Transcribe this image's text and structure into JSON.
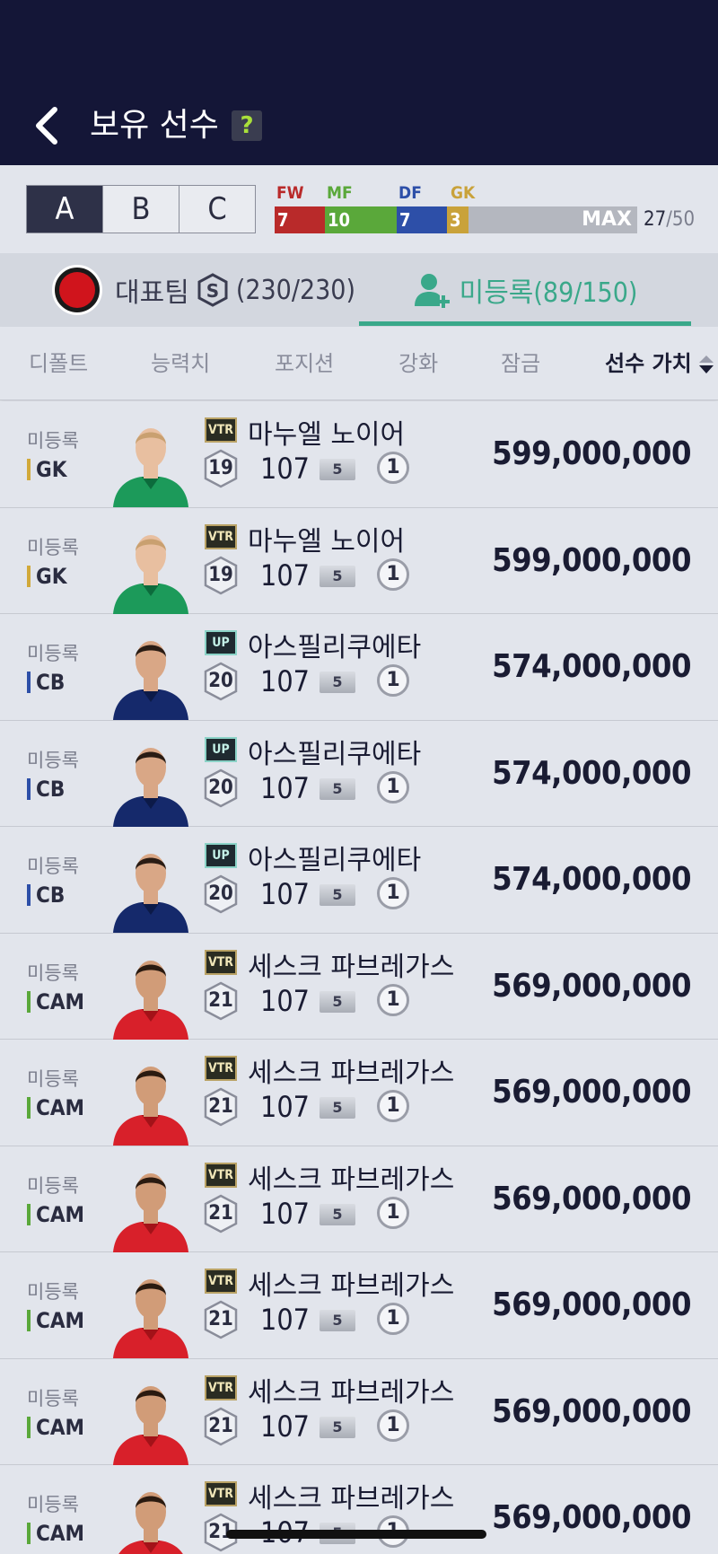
{
  "header": {
    "title": "보유 선수",
    "help": "?"
  },
  "squad": {
    "tabs": [
      "A",
      "B",
      "C"
    ],
    "active": 0,
    "positions": [
      {
        "label": "FW",
        "count": "7",
        "color": "#b92a2a"
      },
      {
        "label": "MF",
        "count": "10",
        "color": "#5aa83a"
      },
      {
        "label": "DF",
        "count": "7",
        "color": "#2d4fa8"
      },
      {
        "label": "GK",
        "count": "3",
        "color": "#c9a23a"
      }
    ],
    "max_label": "MAX",
    "current": "27",
    "max": "/50"
  },
  "team": {
    "main_label": "대표팀",
    "s_badge": "S",
    "main_count": "(230/230)",
    "unregistered_label": "미등록(89/150)"
  },
  "sort": {
    "items": [
      "디폴트",
      "능력치",
      "포지션",
      "강화",
      "잠금",
      "선수 가치"
    ],
    "active": 5
  },
  "players": [
    {
      "status": "미등록",
      "pos": "GK",
      "pos_color": "#d1a93a",
      "season": "VTR",
      "name": "마누엘 노이어",
      "level": "19",
      "ovr": "107",
      "enh": "5",
      "count": "1",
      "value": "599,000,000",
      "kit": "gk"
    },
    {
      "status": "미등록",
      "pos": "GK",
      "pos_color": "#d1a93a",
      "season": "VTR",
      "name": "마누엘 노이어",
      "level": "19",
      "ovr": "107",
      "enh": "5",
      "count": "1",
      "value": "599,000,000",
      "kit": "gk"
    },
    {
      "status": "미등록",
      "pos": "CB",
      "pos_color": "#2d4fa8",
      "season": "UP",
      "name": "아스필리쿠에타",
      "level": "20",
      "ovr": "107",
      "enh": "5",
      "count": "1",
      "value": "574,000,000",
      "kit": "blue"
    },
    {
      "status": "미등록",
      "pos": "CB",
      "pos_color": "#2d4fa8",
      "season": "UP",
      "name": "아스필리쿠에타",
      "level": "20",
      "ovr": "107",
      "enh": "5",
      "count": "1",
      "value": "574,000,000",
      "kit": "blue"
    },
    {
      "status": "미등록",
      "pos": "CB",
      "pos_color": "#2d4fa8",
      "season": "UP",
      "name": "아스필리쿠에타",
      "level": "20",
      "ovr": "107",
      "enh": "5",
      "count": "1",
      "value": "574,000,000",
      "kit": "blue"
    },
    {
      "status": "미등록",
      "pos": "CAM",
      "pos_color": "#5aa83a",
      "season": "VTR",
      "name": "세스크 파브레가스",
      "level": "21",
      "ovr": "107",
      "enh": "5",
      "count": "1",
      "value": "569,000,000",
      "kit": "red"
    },
    {
      "status": "미등록",
      "pos": "CAM",
      "pos_color": "#5aa83a",
      "season": "VTR",
      "name": "세스크 파브레가스",
      "level": "21",
      "ovr": "107",
      "enh": "5",
      "count": "1",
      "value": "569,000,000",
      "kit": "red"
    },
    {
      "status": "미등록",
      "pos": "CAM",
      "pos_color": "#5aa83a",
      "season": "VTR",
      "name": "세스크 파브레가스",
      "level": "21",
      "ovr": "107",
      "enh": "5",
      "count": "1",
      "value": "569,000,000",
      "kit": "red"
    },
    {
      "status": "미등록",
      "pos": "CAM",
      "pos_color": "#5aa83a",
      "season": "VTR",
      "name": "세스크 파브레가스",
      "level": "21",
      "ovr": "107",
      "enh": "5",
      "count": "1",
      "value": "569,000,000",
      "kit": "red"
    },
    {
      "status": "미등록",
      "pos": "CAM",
      "pos_color": "#5aa83a",
      "season": "VTR",
      "name": "세스크 파브레가스",
      "level": "21",
      "ovr": "107",
      "enh": "5",
      "count": "1",
      "value": "569,000,000",
      "kit": "red"
    },
    {
      "status": "미등록",
      "pos": "CAM",
      "pos_color": "#5aa83a",
      "season": "VTR",
      "name": "세스크 파브레가스",
      "level": "21",
      "ovr": "107",
      "enh": "5",
      "count": "1",
      "value": "569,000,000",
      "kit": "red"
    }
  ]
}
